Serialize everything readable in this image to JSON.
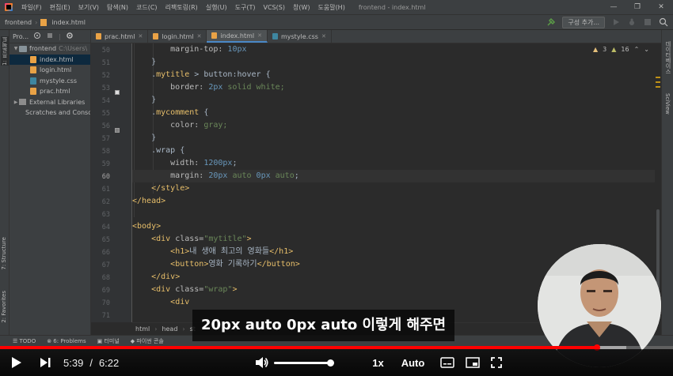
{
  "menubar": {
    "items": [
      "파일(F)",
      "편집(E)",
      "보기(V)",
      "탐색(N)",
      "코드(C)",
      "리팩토링(R)",
      "실행(U)",
      "도구(T)",
      "VCS(S)",
      "창(W)",
      "도움말(H)"
    ],
    "window_title": "frontend - index.html",
    "controls": [
      "—",
      "❐",
      "✕"
    ]
  },
  "navbar": {
    "project": "frontend",
    "file": "index.html",
    "run_config": "구성 추가..."
  },
  "left_stripe": {
    "project_tab": "1: 프로젝트",
    "structure_tab": "7: Structure",
    "favorites_tab": "2: Favorites"
  },
  "project_panel": {
    "header": "Pro...",
    "tree": [
      {
        "label": "frontend",
        "path": "C:\\Users\\",
        "type": "folder",
        "expanded": true,
        "indent": 0
      },
      {
        "label": "index.html",
        "type": "html",
        "indent": 1,
        "selected": true
      },
      {
        "label": "login.html",
        "type": "html",
        "indent": 1
      },
      {
        "label": "mystyle.css",
        "type": "css",
        "indent": 1
      },
      {
        "label": "prac.html",
        "type": "html",
        "indent": 1
      },
      {
        "label": "External Libraries",
        "type": "lib",
        "indent": 0
      },
      {
        "label": "Scratches and Conso",
        "type": "scratch",
        "indent": 0
      }
    ]
  },
  "tabs": [
    {
      "label": "prac.html",
      "type": "html",
      "active": false
    },
    {
      "label": "login.html",
      "type": "html",
      "active": false
    },
    {
      "label": "index.html",
      "type": "html",
      "active": true
    },
    {
      "label": "mystyle.css",
      "type": "css",
      "active": false
    }
  ],
  "inspection": {
    "warnings": "3",
    "weak_warnings": "16"
  },
  "right_stripe": {
    "database_tab": "데이터베이스",
    "sciview_tab": "SciView"
  },
  "code": {
    "line_numbers": [
      "50",
      "51",
      "52",
      "53",
      "54",
      "55",
      "56",
      "57",
      "58",
      "59",
      "60",
      "61",
      "62",
      "63",
      "64",
      "65",
      "66",
      "67",
      "68",
      "69",
      "70",
      "71"
    ],
    "current_line": "60",
    "lines": [
      [
        {
          "t": "        margin-top: ",
          "c": "prop"
        },
        {
          "t": "10px",
          "c": "num"
        }
      ],
      [
        {
          "t": "    }",
          "c": "punc"
        }
      ],
      [
        {
          "t": "    .",
          "c": "punc"
        },
        {
          "t": "mytitle",
          "c": "sel"
        },
        {
          "t": " > button:hover {",
          "c": "punc"
        }
      ],
      [
        {
          "t": "        border: ",
          "c": "prop"
        },
        {
          "t": "2px",
          "c": "num"
        },
        {
          "t": " solid white;",
          "c": "str"
        }
      ],
      [
        {
          "t": "    }",
          "c": "punc"
        }
      ],
      [
        {
          "t": "    .",
          "c": "punc"
        },
        {
          "t": "mycomment",
          "c": "sel"
        },
        {
          "t": " {",
          "c": "punc"
        }
      ],
      [
        {
          "t": "        color: ",
          "c": "prop"
        },
        {
          "t": "gray;",
          "c": "str"
        }
      ],
      [
        {
          "t": "    }",
          "c": "punc"
        }
      ],
      [
        {
          "t": "    .wrap {",
          "c": "punc"
        }
      ],
      [
        {
          "t": "        width: ",
          "c": "prop"
        },
        {
          "t": "1200px",
          "c": "num"
        },
        {
          "t": ";",
          "c": "punc"
        }
      ],
      [
        {
          "t": "        margin: ",
          "c": "prop"
        },
        {
          "t": "20px",
          "c": "num"
        },
        {
          "t": " auto ",
          "c": "str"
        },
        {
          "t": "0px",
          "c": "num"
        },
        {
          "t": " auto",
          "c": "str"
        },
        {
          "t": ";",
          "c": "punc"
        }
      ],
      [
        {
          "t": "    ",
          "c": "plain"
        },
        {
          "t": "</style>",
          "c": "tag"
        }
      ],
      [
        {
          "t": "</head>",
          "c": "tag"
        }
      ],
      [
        {
          "t": "",
          "c": "plain"
        }
      ],
      [
        {
          "t": "<body>",
          "c": "tag"
        }
      ],
      [
        {
          "t": "    ",
          "c": "plain"
        },
        {
          "t": "<div ",
          "c": "tag"
        },
        {
          "t": "class=",
          "c": "attr"
        },
        {
          "t": "\"mytitle\"",
          "c": "str"
        },
        {
          "t": ">",
          "c": "tag"
        }
      ],
      [
        {
          "t": "        ",
          "c": "plain"
        },
        {
          "t": "<h1>",
          "c": "tag"
        },
        {
          "t": "내 생애 최고의 영화들",
          "c": "plain"
        },
        {
          "t": "</h1>",
          "c": "tag"
        }
      ],
      [
        {
          "t": "        ",
          "c": "plain"
        },
        {
          "t": "<button>",
          "c": "tag"
        },
        {
          "t": "영화 기록하기",
          "c": "plain"
        },
        {
          "t": "</button>",
          "c": "tag"
        }
      ],
      [
        {
          "t": "    ",
          "c": "plain"
        },
        {
          "t": "</div>",
          "c": "tag"
        }
      ],
      [
        {
          "t": "    ",
          "c": "plain"
        },
        {
          "t": "<div ",
          "c": "tag"
        },
        {
          "t": "class=",
          "c": "attr"
        },
        {
          "t": "\"wrap\"",
          "c": "str"
        },
        {
          "t": ">",
          "c": "tag"
        }
      ],
      [
        {
          "t": "        ",
          "c": "plain"
        },
        {
          "t": "<div",
          "c": "tag"
        }
      ],
      [
        {
          "t": "",
          "c": "plain"
        }
      ]
    ]
  },
  "editor_breadcrumb": [
    "html",
    "head",
    "st"
  ],
  "tool_bar": {
    "items": [
      "TODO",
      "6: Problems",
      "터미널",
      "파이썬 콘솔"
    ]
  },
  "player": {
    "current_time": "5:39",
    "time_separator": "/",
    "duration": "6:22",
    "progress": 0.887,
    "buffered": 0.93,
    "speed": "1x",
    "quality": "Auto",
    "colors": {
      "progress": "#ff0000",
      "text": "#ffffff"
    }
  },
  "subtitle": "20px auto 0px auto 이렇게 해주면"
}
